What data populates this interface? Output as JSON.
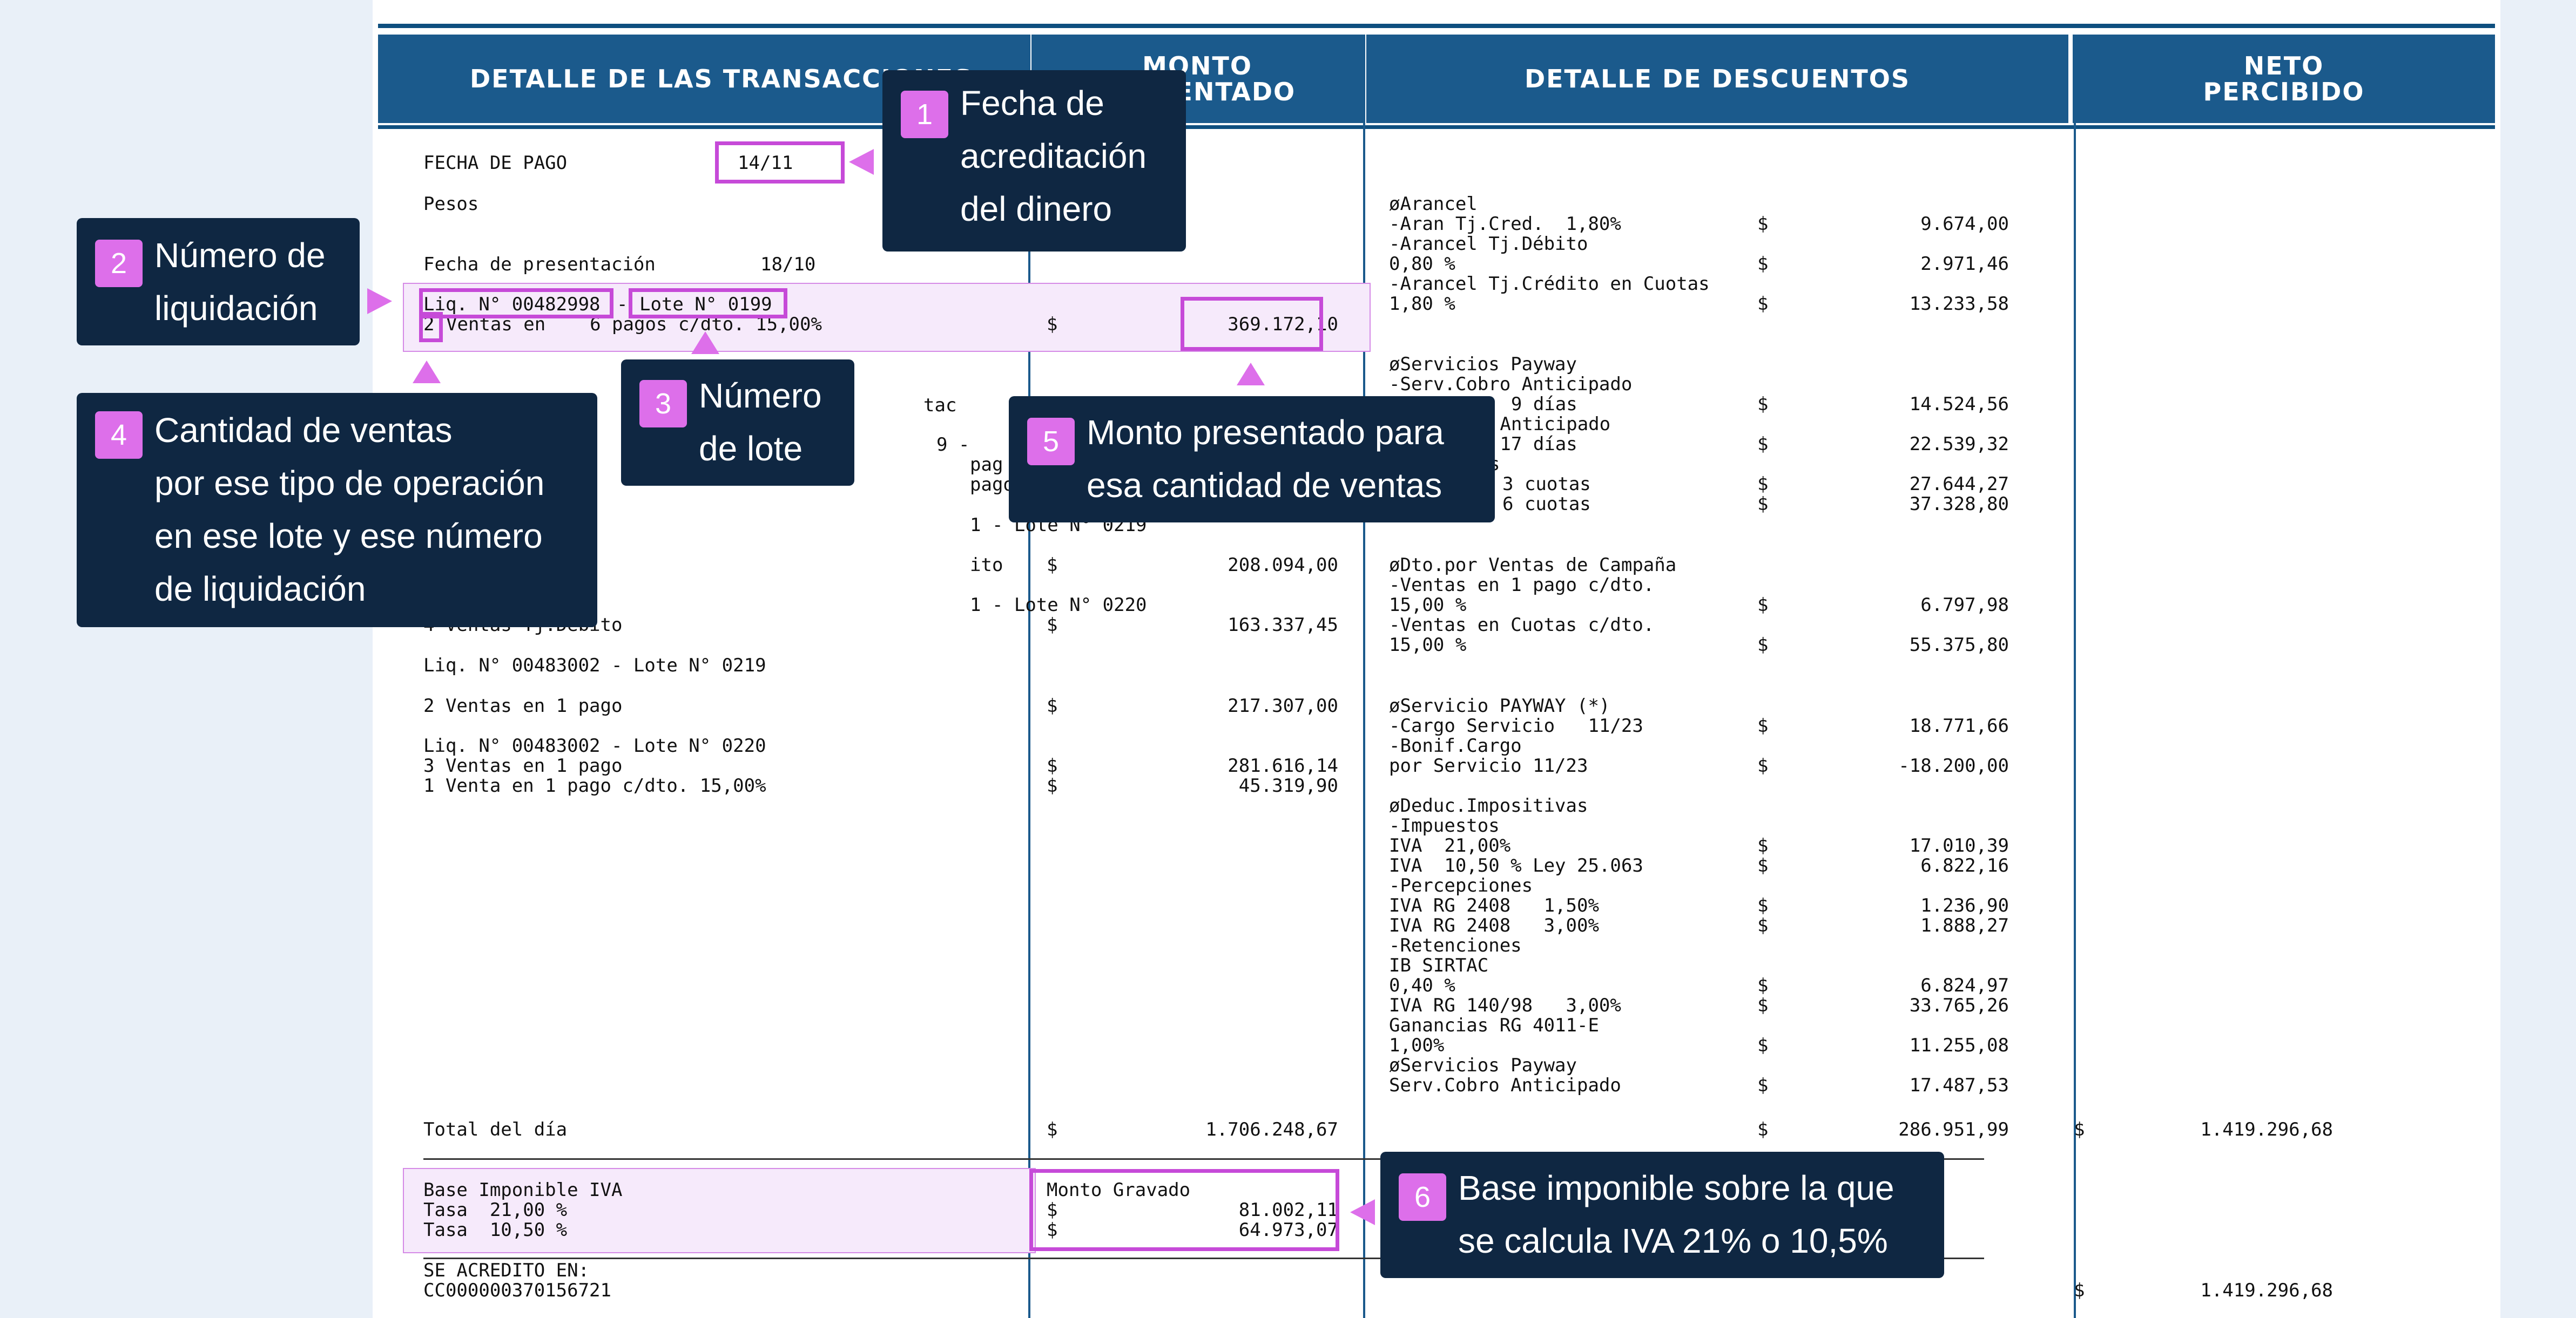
{
  "headers": {
    "detalle_transacciones": "DETALLE DE LAS TRANSACCIONES",
    "monto_presentado": "MONTO\nPRESENTADO",
    "detalle_descuentos": "DETALLE DE DESCUENTOS",
    "neto_percibido": "NETO\nPERCIBIDO"
  },
  "transactions": {
    "fecha_pago_label": "FECHA DE PAGO",
    "fecha_pago_value": "14/11",
    "moneda": "Pesos",
    "fecha_presentacion_label": "Fecha de presentación",
    "fecha_presentacion_value": "18/10",
    "liq_1": "Liq. N° 00482998",
    "lote_1": "Lote N° 0199",
    "line_1a_qty": "2",
    "line_1a_rest": "Ventas en    6 pagos c/dto. 15,00%",
    "line_1a_amt": "369.172,10",
    "frag_a": "tac",
    "frag_b": "9 -",
    "frag_c": "pag",
    "frag_d": "pagos - P.A. 6",
    "frag_e": "1 - Lote N° 0219",
    "frag_f": "ito",
    "frag_g": "1 - Lote N° 0220",
    "frag_h": "4 Ventas Tj.Débito",
    "amt_2": "208.094,00",
    "amt_3": "163.337,45",
    "liq_3": "Liq. N° 00483002 - Lote N° 0219",
    "line_4": "2 Ventas en 1 pago",
    "amt_4": "217.307,00",
    "liq_4": "Liq. N° 00483002 - Lote N° 0220",
    "line_5a": "3 Ventas en 1 pago",
    "amt_5a": "281.616,14",
    "line_5b": "1 Venta en 1 pago c/dto. 15,00%",
    "amt_5b": "45.319,90",
    "total_label": "Total del día",
    "total_amt": "1.706.248,67",
    "base_label": "Base Imponible IVA",
    "tasa_21": "Tasa  21,00 %",
    "tasa_105": "Tasa  10,50 %",
    "monto_gravado_label": "Monto Gravado",
    "gravado_21": "81.002,11",
    "gravado_105": "64.973,07",
    "acredito_label": "SE ACREDITO EN:",
    "cuenta": "CC000000370156721",
    "currency": "$"
  },
  "discounts": {
    "arancel_title": "øArancel",
    "aran_cred": "-Aran Tj.Cred.  1,80%",
    "aran_cred_amt": "9.674,00",
    "aran_deb": "-Arancel Tj.Débito",
    "aran_deb_pct": "0,80 %",
    "aran_deb_amt": "2.971,46",
    "aran_cuotas": "-Arancel Tj.Crédito en Cuotas",
    "aran_cuotas_pct": "1,80 %",
    "aran_cuotas_amt": "13.233,58",
    "serv_title": "øServicios Payway",
    "serv_cobro": "-Serv.Cobro Anticipado",
    "serv_9": "en  9 días",
    "serv_9_amt": "14.524,56",
    "serv_cobro2": "ro Anticipado",
    "serv_17": "en 17 días",
    "serv_17_amt": "22.539,32",
    "serv_tas": "tas",
    "serv_3": "3 cuotas",
    "serv_3_amt": "27.644,27",
    "serv_6": "6 cuotas",
    "serv_6_amt": "37.328,80",
    "dto_title": "øDto.por Ventas de Campaña",
    "dto_1pago": "-Ventas en 1 pago c/dto.",
    "dto_1pago_pct": "15,00 %",
    "dto_1pago_amt": "6.797,98",
    "dto_cuotas": "-Ventas en Cuotas c/dto.",
    "dto_cuotas_pct": "15,00 %",
    "dto_cuotas_amt": "55.375,80",
    "payway_title": "øServicio PAYWAY (*)",
    "cargo_servicio": "-Cargo Servicio   11/23",
    "cargo_servicio_amt": "18.771,66",
    "bonif_cargo": "-Bonif.Cargo",
    "por_servicio": "por Servicio 11/23",
    "bonif_amt": "-18.200,00",
    "deduc_title": "øDeduc.Impositivas",
    "impuestos": "-Impuestos",
    "iva21": "IVA  21,00%",
    "iva21_amt": "17.010,39",
    "iva105": "IVA  10,50 % Ley 25.063",
    "iva105_amt": "6.822,16",
    "percepciones": "-Percepciones",
    "perc_15": "IVA RG 2408   1,50%",
    "perc_15_amt": "1.236,90",
    "perc_3": "IVA RG 2408   3,00%",
    "perc_3_amt": "1.888,27",
    "retenciones": "-Retenciones",
    "ib_sirtac": "IB SIRTAC",
    "ib_pct": "0,40 %",
    "ib_amt": "6.824,97",
    "rg140": "IVA RG 140/98   3,00%",
    "rg140_amt": "33.765,26",
    "ganancias": "Ganancias RG 4011-E",
    "ganancias_pct": "1,00%",
    "ganancias_amt": "11.255,08",
    "serv2_title": "øServicios Payway",
    "serv2_cobro": "Serv.Cobro Anticipado",
    "serv2_amt": "17.487,53",
    "total_amt": "286.951,99"
  },
  "neto": {
    "total_amt": "1.419.296,68",
    "acreditado_amt": "1.419.296,68"
  },
  "callouts": [
    {
      "num": "1",
      "text": "Fecha de\nacreditación\ndel dinero"
    },
    {
      "num": "2",
      "text": "Número de\nliquidación"
    },
    {
      "num": "3",
      "text": "Número\nde lote"
    },
    {
      "num": "4",
      "text": "Cantidad de ventas\npor ese tipo de operación\nen ese lote y ese número\nde liquidación"
    },
    {
      "num": "5",
      "text": "Monto presentado para\nesa cantidad de ventas"
    },
    {
      "num": "6",
      "text": "Base imponible sobre la que\nse calcula IVA 21% o 10,5%"
    }
  ],
  "colors": {
    "header_bg": "#1b5a8c",
    "callout_bg": "#0f2742",
    "badge": "#dd6fea",
    "highlight": "#c64ad8",
    "page_bg": "#e9f0f8"
  }
}
